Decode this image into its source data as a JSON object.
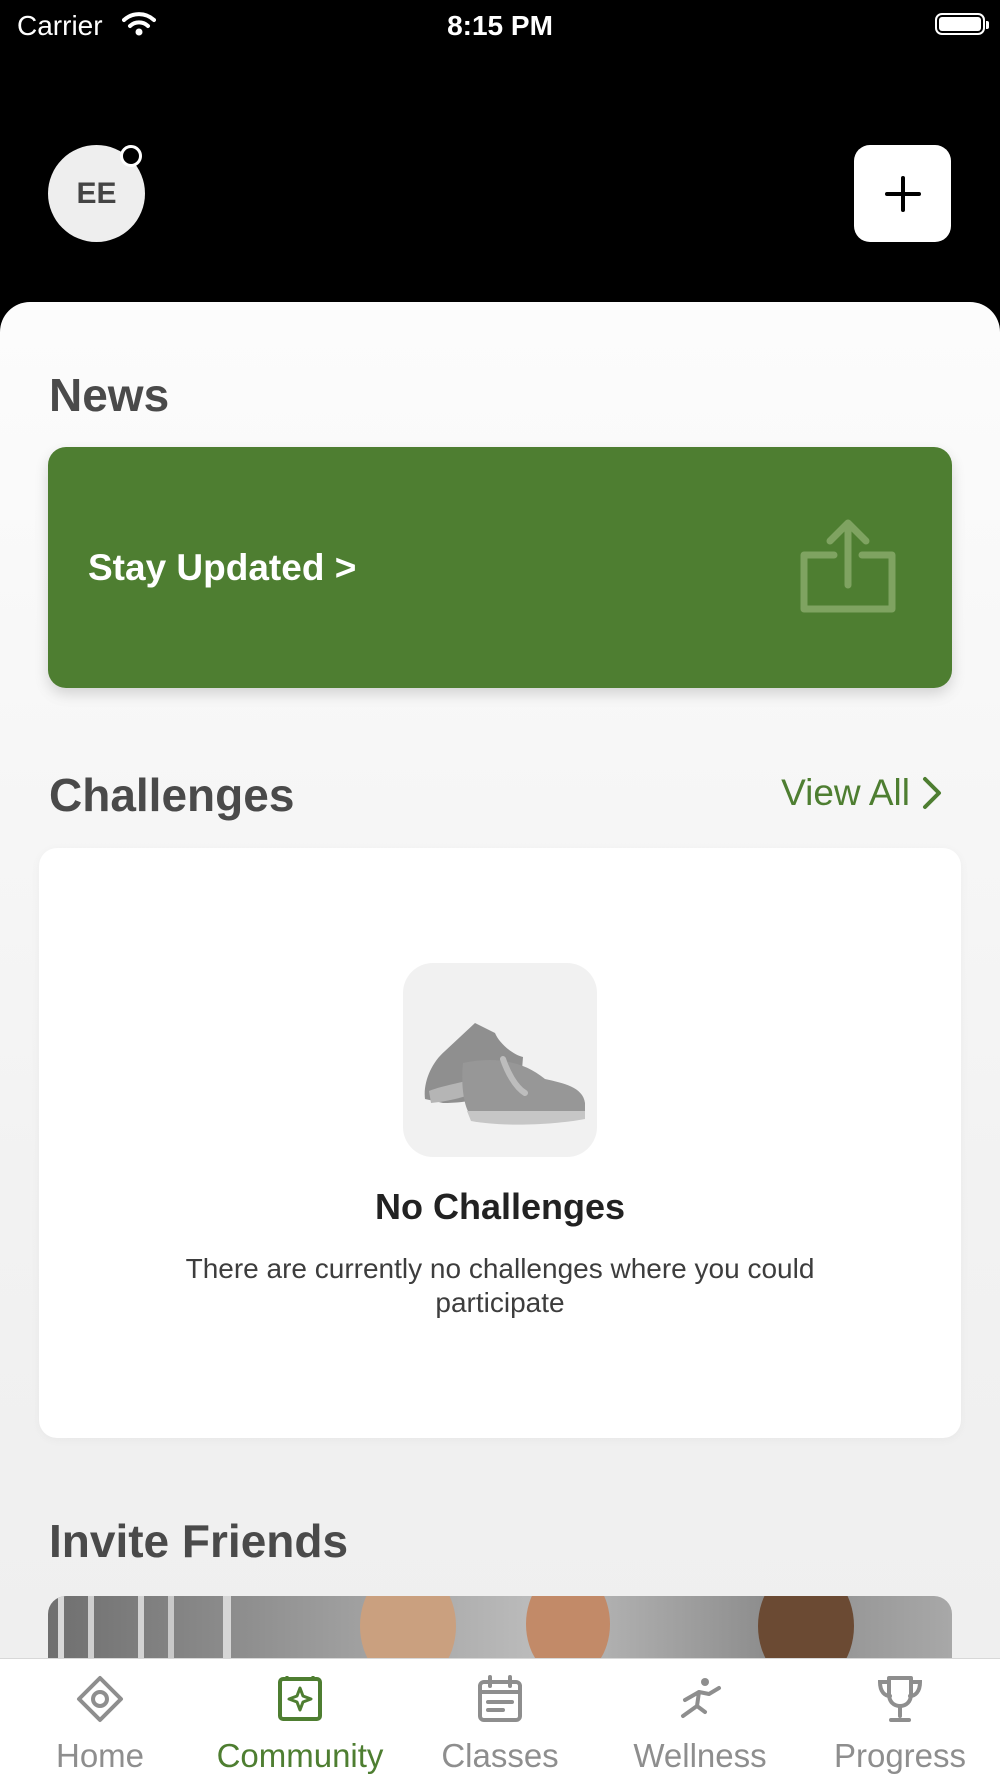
{
  "status_bar": {
    "carrier": "Carrier",
    "time": "8:15 PM"
  },
  "header": {
    "avatar_initials": "EE"
  },
  "news": {
    "title": "News",
    "card_label": "Stay Updated >"
  },
  "challenges": {
    "title": "Challenges",
    "view_all": "View All",
    "empty_title": "No Challenges",
    "empty_description": "There are currently no challenges where you could participate"
  },
  "invite": {
    "title": "Invite Friends"
  },
  "tabs": [
    {
      "label": "Home",
      "icon": "home-icon"
    },
    {
      "label": "Community",
      "icon": "community-icon",
      "active": true
    },
    {
      "label": "Classes",
      "icon": "classes-icon"
    },
    {
      "label": "Wellness",
      "icon": "wellness-icon"
    },
    {
      "label": "Progress",
      "icon": "trophy-icon"
    }
  ],
  "colors": {
    "accent": "#4e7e31",
    "background": "#000000",
    "inactive": "#8e8e8e"
  }
}
